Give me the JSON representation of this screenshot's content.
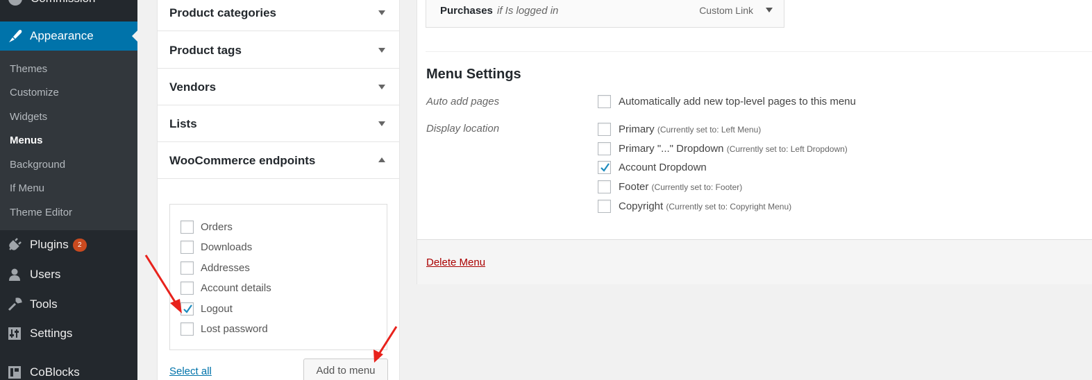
{
  "sidebar": {
    "top_item": "Commission",
    "appearance": "Appearance",
    "submenu": [
      "Themes",
      "Customize",
      "Widgets",
      "Menus",
      "Background",
      "If Menu",
      "Theme Editor"
    ],
    "current_submenu": "Menus",
    "plugins": "Plugins",
    "plugins_badge": "2",
    "users": "Users",
    "tools": "Tools",
    "settings": "Settings",
    "coblocks": "CoBlocks",
    "accent_color": "#0073aa",
    "badge_color": "#ca4a1f"
  },
  "accordion": {
    "sections": [
      "Product categories",
      "Product tags",
      "Vendors",
      "Lists"
    ],
    "open_section": "WooCommerce endpoints",
    "endpoints": [
      {
        "label": "Orders",
        "checked": false
      },
      {
        "label": "Downloads",
        "checked": false
      },
      {
        "label": "Addresses",
        "checked": false
      },
      {
        "label": "Account details",
        "checked": false
      },
      {
        "label": "Logout",
        "checked": true
      },
      {
        "label": "Lost password",
        "checked": false
      }
    ],
    "select_all": "Select all",
    "add_to_menu": "Add to menu"
  },
  "menu_item": {
    "title": "Purchases",
    "condition": "if Is logged in",
    "type": "Custom Link"
  },
  "menu_settings": {
    "title": "Menu Settings",
    "auto_add_label": "Auto add pages",
    "auto_add_option": "Automatically add new top-level pages to this menu",
    "auto_add_checked": false,
    "display_location_label": "Display location",
    "locations": [
      {
        "label": "Primary",
        "note": "(Currently set to: Left Menu)",
        "checked": false
      },
      {
        "label": "Primary \"...\" Dropdown",
        "note": "(Currently set to: Left Dropdown)",
        "checked": false
      },
      {
        "label": "Account Dropdown",
        "note": "",
        "checked": true
      },
      {
        "label": "Footer",
        "note": "(Currently set to: Footer)",
        "checked": false
      },
      {
        "label": "Copyright",
        "note": "(Currently set to: Copyright Menu)",
        "checked": false
      }
    ]
  },
  "delete_menu": "Delete Menu"
}
